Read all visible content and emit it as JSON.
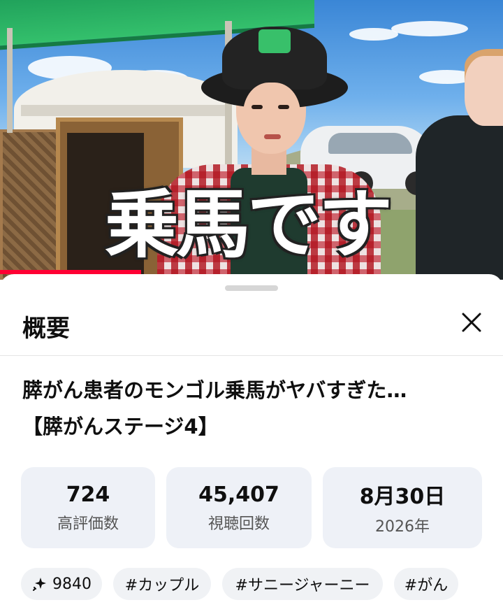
{
  "video": {
    "caption": "乗馬です",
    "progress_fraction": 0.28,
    "accent_color": "#ff0033"
  },
  "sheet": {
    "header": "概要",
    "close_icon": "close-icon",
    "title_line1": "膵がん患者のモンゴル乗馬がヤバすぎた…",
    "title_line2": "【膵がんステージ4】",
    "stats": [
      {
        "value": "724",
        "label": "高評価数"
      },
      {
        "value": "45,407",
        "label": "視聴回数"
      },
      {
        "value": "8月30日",
        "label": "2026年"
      }
    ],
    "chips": [
      {
        "icon": "sparkle-icon",
        "label": "9840"
      },
      {
        "label": "#カップル"
      },
      {
        "label": "#サニージャーニー"
      },
      {
        "label": "#がん"
      }
    ]
  }
}
